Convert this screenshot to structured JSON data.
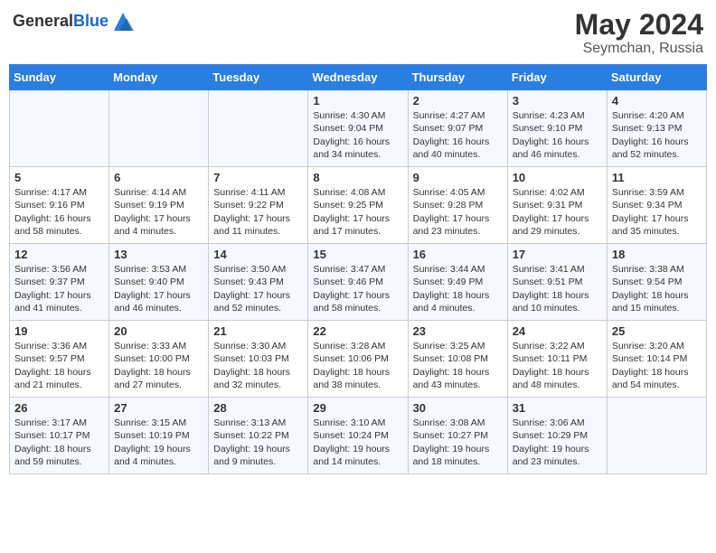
{
  "logo": {
    "general": "General",
    "blue": "Blue"
  },
  "title": {
    "month_year": "May 2024",
    "location": "Seymchan, Russia"
  },
  "headers": [
    "Sunday",
    "Monday",
    "Tuesday",
    "Wednesday",
    "Thursday",
    "Friday",
    "Saturday"
  ],
  "weeks": [
    [
      {
        "day": "",
        "sunrise": "",
        "sunset": "",
        "daylight": ""
      },
      {
        "day": "",
        "sunrise": "",
        "sunset": "",
        "daylight": ""
      },
      {
        "day": "",
        "sunrise": "",
        "sunset": "",
        "daylight": ""
      },
      {
        "day": "1",
        "sunrise": "Sunrise: 4:30 AM",
        "sunset": "Sunset: 9:04 PM",
        "daylight": "Daylight: 16 hours and 34 minutes."
      },
      {
        "day": "2",
        "sunrise": "Sunrise: 4:27 AM",
        "sunset": "Sunset: 9:07 PM",
        "daylight": "Daylight: 16 hours and 40 minutes."
      },
      {
        "day": "3",
        "sunrise": "Sunrise: 4:23 AM",
        "sunset": "Sunset: 9:10 PM",
        "daylight": "Daylight: 16 hours and 46 minutes."
      },
      {
        "day": "4",
        "sunrise": "Sunrise: 4:20 AM",
        "sunset": "Sunset: 9:13 PM",
        "daylight": "Daylight: 16 hours and 52 minutes."
      }
    ],
    [
      {
        "day": "5",
        "sunrise": "Sunrise: 4:17 AM",
        "sunset": "Sunset: 9:16 PM",
        "daylight": "Daylight: 16 hours and 58 minutes."
      },
      {
        "day": "6",
        "sunrise": "Sunrise: 4:14 AM",
        "sunset": "Sunset: 9:19 PM",
        "daylight": "Daylight: 17 hours and 4 minutes."
      },
      {
        "day": "7",
        "sunrise": "Sunrise: 4:11 AM",
        "sunset": "Sunset: 9:22 PM",
        "daylight": "Daylight: 17 hours and 11 minutes."
      },
      {
        "day": "8",
        "sunrise": "Sunrise: 4:08 AM",
        "sunset": "Sunset: 9:25 PM",
        "daylight": "Daylight: 17 hours and 17 minutes."
      },
      {
        "day": "9",
        "sunrise": "Sunrise: 4:05 AM",
        "sunset": "Sunset: 9:28 PM",
        "daylight": "Daylight: 17 hours and 23 minutes."
      },
      {
        "day": "10",
        "sunrise": "Sunrise: 4:02 AM",
        "sunset": "Sunset: 9:31 PM",
        "daylight": "Daylight: 17 hours and 29 minutes."
      },
      {
        "day": "11",
        "sunrise": "Sunrise: 3:59 AM",
        "sunset": "Sunset: 9:34 PM",
        "daylight": "Daylight: 17 hours and 35 minutes."
      }
    ],
    [
      {
        "day": "12",
        "sunrise": "Sunrise: 3:56 AM",
        "sunset": "Sunset: 9:37 PM",
        "daylight": "Daylight: 17 hours and 41 minutes."
      },
      {
        "day": "13",
        "sunrise": "Sunrise: 3:53 AM",
        "sunset": "Sunset: 9:40 PM",
        "daylight": "Daylight: 17 hours and 46 minutes."
      },
      {
        "day": "14",
        "sunrise": "Sunrise: 3:50 AM",
        "sunset": "Sunset: 9:43 PM",
        "daylight": "Daylight: 17 hours and 52 minutes."
      },
      {
        "day": "15",
        "sunrise": "Sunrise: 3:47 AM",
        "sunset": "Sunset: 9:46 PM",
        "daylight": "Daylight: 17 hours and 58 minutes."
      },
      {
        "day": "16",
        "sunrise": "Sunrise: 3:44 AM",
        "sunset": "Sunset: 9:49 PM",
        "daylight": "Daylight: 18 hours and 4 minutes."
      },
      {
        "day": "17",
        "sunrise": "Sunrise: 3:41 AM",
        "sunset": "Sunset: 9:51 PM",
        "daylight": "Daylight: 18 hours and 10 minutes."
      },
      {
        "day": "18",
        "sunrise": "Sunrise: 3:38 AM",
        "sunset": "Sunset: 9:54 PM",
        "daylight": "Daylight: 18 hours and 15 minutes."
      }
    ],
    [
      {
        "day": "19",
        "sunrise": "Sunrise: 3:36 AM",
        "sunset": "Sunset: 9:57 PM",
        "daylight": "Daylight: 18 hours and 21 minutes."
      },
      {
        "day": "20",
        "sunrise": "Sunrise: 3:33 AM",
        "sunset": "Sunset: 10:00 PM",
        "daylight": "Daylight: 18 hours and 27 minutes."
      },
      {
        "day": "21",
        "sunrise": "Sunrise: 3:30 AM",
        "sunset": "Sunset: 10:03 PM",
        "daylight": "Daylight: 18 hours and 32 minutes."
      },
      {
        "day": "22",
        "sunrise": "Sunrise: 3:28 AM",
        "sunset": "Sunset: 10:06 PM",
        "daylight": "Daylight: 18 hours and 38 minutes."
      },
      {
        "day": "23",
        "sunrise": "Sunrise: 3:25 AM",
        "sunset": "Sunset: 10:08 PM",
        "daylight": "Daylight: 18 hours and 43 minutes."
      },
      {
        "day": "24",
        "sunrise": "Sunrise: 3:22 AM",
        "sunset": "Sunset: 10:11 PM",
        "daylight": "Daylight: 18 hours and 48 minutes."
      },
      {
        "day": "25",
        "sunrise": "Sunrise: 3:20 AM",
        "sunset": "Sunset: 10:14 PM",
        "daylight": "Daylight: 18 hours and 54 minutes."
      }
    ],
    [
      {
        "day": "26",
        "sunrise": "Sunrise: 3:17 AM",
        "sunset": "Sunset: 10:17 PM",
        "daylight": "Daylight: 18 hours and 59 minutes."
      },
      {
        "day": "27",
        "sunrise": "Sunrise: 3:15 AM",
        "sunset": "Sunset: 10:19 PM",
        "daylight": "Daylight: 19 hours and 4 minutes."
      },
      {
        "day": "28",
        "sunrise": "Sunrise: 3:13 AM",
        "sunset": "Sunset: 10:22 PM",
        "daylight": "Daylight: 19 hours and 9 minutes."
      },
      {
        "day": "29",
        "sunrise": "Sunrise: 3:10 AM",
        "sunset": "Sunset: 10:24 PM",
        "daylight": "Daylight: 19 hours and 14 minutes."
      },
      {
        "day": "30",
        "sunrise": "Sunrise: 3:08 AM",
        "sunset": "Sunset: 10:27 PM",
        "daylight": "Daylight: 19 hours and 18 minutes."
      },
      {
        "day": "31",
        "sunrise": "Sunrise: 3:06 AM",
        "sunset": "Sunset: 10:29 PM",
        "daylight": "Daylight: 19 hours and 23 minutes."
      },
      {
        "day": "",
        "sunrise": "",
        "sunset": "",
        "daylight": ""
      }
    ]
  ]
}
